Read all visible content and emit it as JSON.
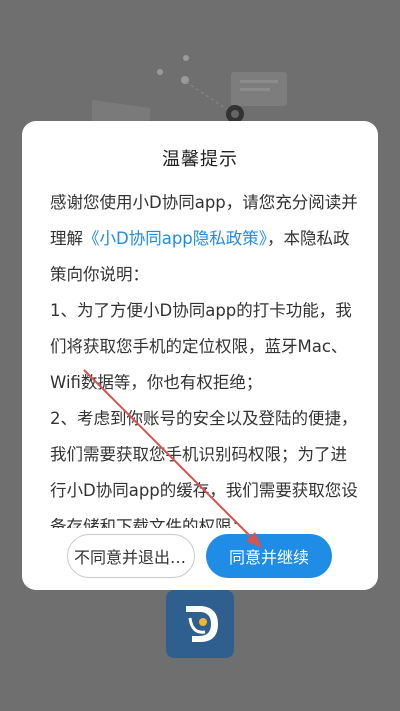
{
  "dialog": {
    "title": "温馨提示",
    "para1_prefix": "感谢您使用小D协同app，请您充分阅读并理解",
    "policy_link": "《小D协同app隐私政策》",
    "para1_suffix": "，本隐私政策向你说明：",
    "para2": "1、为了方便小D协同app的打卡功能，我们将获取您手机的定位权限，蓝牙Mac、Wifi数据等，你也有权拒绝；",
    "para3": "2、考虑到你账号的安全以及登陆的便捷，我们需要获取您手机识别码权限；为了进行小D协同app的缓存，我们需要获取您设备存储和下载文件的权限；",
    "decline_label": "不同意并退出App",
    "accept_label": "同意并继续"
  },
  "colors": {
    "overlay": "#6f6f6f",
    "accent": "#1f8ce6",
    "annotation_arrow": "#d9534f"
  },
  "icons": {
    "app_logo": "xiaod-app-logo",
    "annotation": "red-arrow-annotation"
  }
}
